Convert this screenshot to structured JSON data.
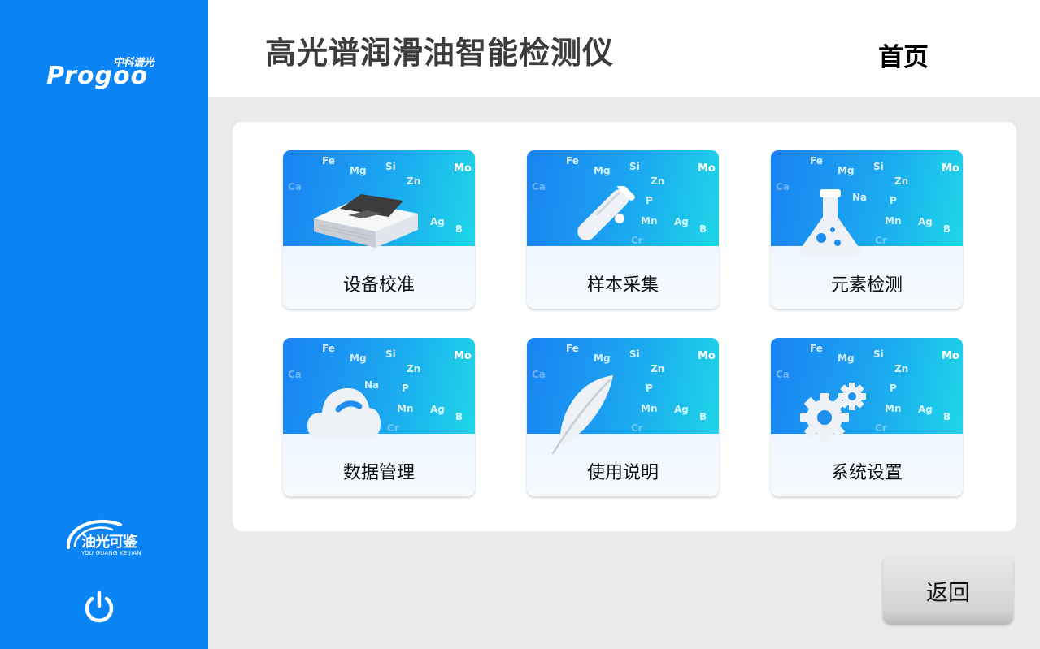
{
  "sidebar": {
    "logo_top_cn": "中科谱光",
    "logo_top_en": "Progoo",
    "logo_bottom_cn": "油光可鉴",
    "logo_bottom_en": "YOU GUANG KE JIAN",
    "power_icon": "power-icon"
  },
  "header": {
    "title": "高光谱润滑油智能检测仪",
    "page": "首页"
  },
  "tiles": [
    {
      "label": "设备校准",
      "icon": "device-icon"
    },
    {
      "label": "样本采集",
      "icon": "test-tube-icon"
    },
    {
      "label": "元素检测",
      "icon": "flask-icon"
    },
    {
      "label": "数据管理",
      "icon": "cloud-icon"
    },
    {
      "label": "使用说明",
      "icon": "feather-icon"
    },
    {
      "label": "系统设置",
      "icon": "gears-icon"
    }
  ],
  "elements": [
    "Fe",
    "Mg",
    "Si",
    "Zn",
    "Mo",
    "Ca",
    "Na",
    "P",
    "Mn",
    "Ag",
    "B",
    "Cr"
  ],
  "back_button": "返回",
  "colors": {
    "sidebar": "#0b85f5",
    "tile_gradient_start": "#1a82f3",
    "tile_gradient_end": "#1ed6e8",
    "background": "#ebebeb"
  }
}
